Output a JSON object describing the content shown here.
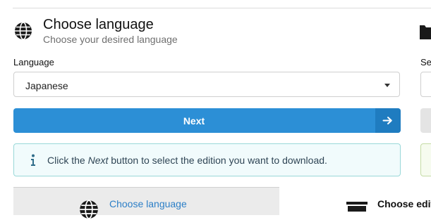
{
  "section": {
    "title": "Choose language",
    "subtitle": "Choose your desired language",
    "icon": "globe-icon"
  },
  "language_field": {
    "label": "Language",
    "selected": "Japanese"
  },
  "next_button": {
    "label": "Next",
    "icon": "arrow-right-icon"
  },
  "info_alert": {
    "icon": "info-icon",
    "text_before": "Click the ",
    "text_emphasis": "Next",
    "text_after": " button to select the edition you want to download."
  },
  "steps": {
    "active_label": "Choose language",
    "next_label": "Choose editi"
  },
  "right_panel": {
    "label_fragment": "Se"
  },
  "colors": {
    "primary": "#2c8fd6",
    "link": "#2c7fc7",
    "info_border": "#99d8d8",
    "info_bg": "#f1fbfc"
  }
}
